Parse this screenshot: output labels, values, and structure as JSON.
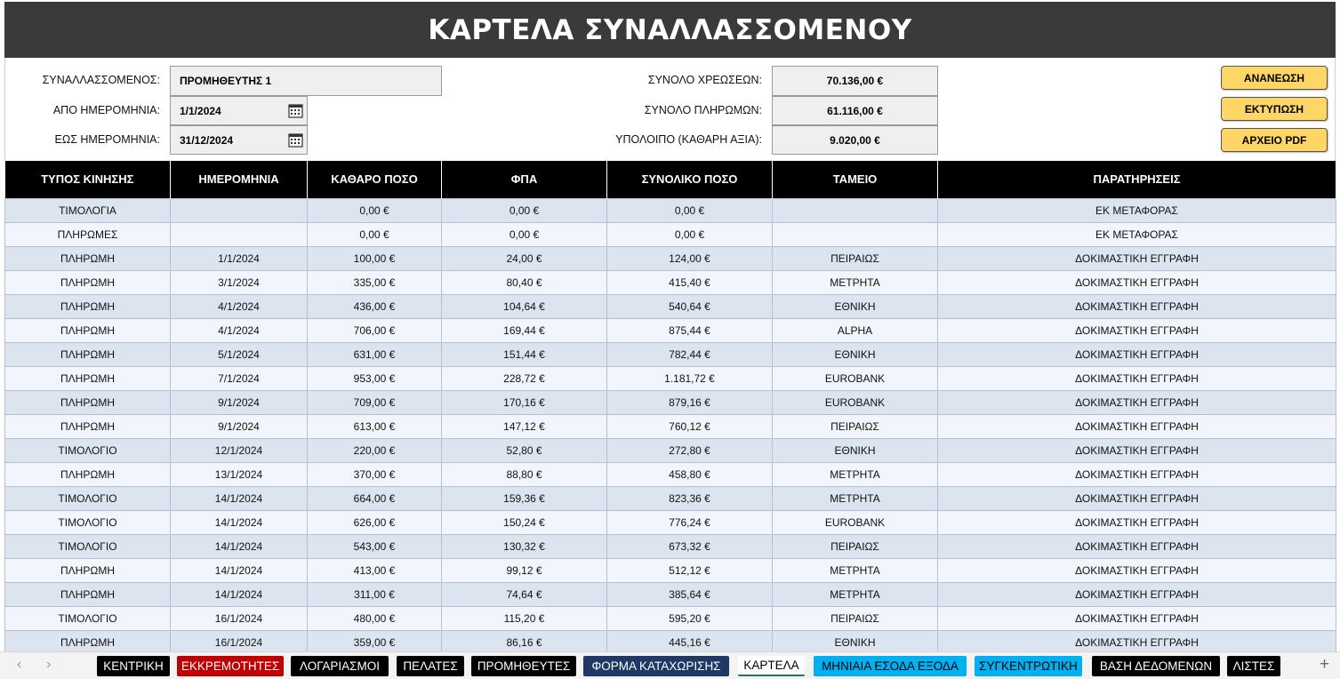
{
  "title": "ΚΑΡΤΕΛΑ ΣΥΝΑΛΛΑΣΣΟΜΕΝΟΥ",
  "form": {
    "party_label": "ΣΥΝΑΛΛΑΣΣΟΜΕΝΟΣ:",
    "party_value": "ΠΡΟΜΗΘΕΥΤΗΣ 1",
    "from_label": "ΑΠΟ ΗΜΕΡΟΜΗΝΙΑ:",
    "from_value": "1/1/2024",
    "to_label": "ΕΩΣ ΗΜΕΡΟΜΗΝΙΑ:",
    "to_value": "31/12/2024",
    "charges_label": "ΣΥΝΟΛΟ ΧΡΕΩΣΕΩΝ:",
    "charges_value": "70.136,00 €",
    "payments_label": "ΣΥΝΟΛΟ ΠΛΗΡΩΜΩΝ:",
    "payments_value": "61.116,00 €",
    "balance_label": "ΥΠΟΛΟΙΠΟ (ΚΑΘΑΡΗ ΑΞΙΑ):",
    "balance_value": "9.020,00 €"
  },
  "buttons": {
    "refresh": "ΑΝΑΝΕΩΣΗ",
    "print": "ΕΚΤΥΠΩΣΗ",
    "pdf": "ΑΡΧΕΙΟ PDF",
    "color": "#fdd665"
  },
  "table": {
    "headers": [
      "ΤΥΠΟΣ ΚΙΝΗΣΗΣ",
      "ΗΜΕΡΟΜΗΝΙΑ",
      "ΚΑΘΑΡΟ ΠΟΣΟ",
      "ΦΠΑ",
      "ΣΥΝΟΛΙΚΟ ΠΟΣΟ",
      "ΤΑΜΕΙΟ",
      "ΠΑΡΑΤΗΡΗΣΕΙΣ"
    ],
    "rows": [
      [
        "ΤΙΜΟΛΟΓΙΑ",
        "",
        "0,00 €",
        "0,00 €",
        "0,00 €",
        "",
        "ΕΚ ΜΕΤΑΦΟΡΑΣ"
      ],
      [
        "ΠΛΗΡΩΜΕΣ",
        "",
        "0,00 €",
        "0,00 €",
        "0,00 €",
        "",
        "ΕΚ ΜΕΤΑΦΟΡΑΣ"
      ],
      [
        "ΠΛΗΡΩΜΗ",
        "1/1/2024",
        "100,00 €",
        "24,00 €",
        "124,00 €",
        "ΠΕΙΡΑΙΩΣ",
        "ΔΟΚΙΜΑΣΤΙΚΗ ΕΓΓΡΑΦΗ"
      ],
      [
        "ΠΛΗΡΩΜΗ",
        "3/1/2024",
        "335,00 €",
        "80,40 €",
        "415,40 €",
        "ΜΕΤΡΗΤΑ",
        "ΔΟΚΙΜΑΣΤΙΚΗ ΕΓΓΡΑΦΗ"
      ],
      [
        "ΠΛΗΡΩΜΗ",
        "4/1/2024",
        "436,00 €",
        "104,64 €",
        "540,64 €",
        "ΕΘΝΙΚΗ",
        "ΔΟΚΙΜΑΣΤΙΚΗ ΕΓΓΡΑΦΗ"
      ],
      [
        "ΠΛΗΡΩΜΗ",
        "4/1/2024",
        "706,00 €",
        "169,44 €",
        "875,44 €",
        "ALPHA",
        "ΔΟΚΙΜΑΣΤΙΚΗ ΕΓΓΡΑΦΗ"
      ],
      [
        "ΠΛΗΡΩΜΗ",
        "5/1/2024",
        "631,00 €",
        "151,44 €",
        "782,44 €",
        "ΕΘΝΙΚΗ",
        "ΔΟΚΙΜΑΣΤΙΚΗ ΕΓΓΡΑΦΗ"
      ],
      [
        "ΠΛΗΡΩΜΗ",
        "7/1/2024",
        "953,00 €",
        "228,72 €",
        "1.181,72 €",
        "EUROBANK",
        "ΔΟΚΙΜΑΣΤΙΚΗ ΕΓΓΡΑΦΗ"
      ],
      [
        "ΠΛΗΡΩΜΗ",
        "9/1/2024",
        "709,00 €",
        "170,16 €",
        "879,16 €",
        "EUROBANK",
        "ΔΟΚΙΜΑΣΤΙΚΗ ΕΓΓΡΑΦΗ"
      ],
      [
        "ΠΛΗΡΩΜΗ",
        "9/1/2024",
        "613,00 €",
        "147,12 €",
        "760,12 €",
        "ΠΕΙΡΑΙΩΣ",
        "ΔΟΚΙΜΑΣΤΙΚΗ ΕΓΓΡΑΦΗ"
      ],
      [
        "ΤΙΜΟΛΟΓΙΟ",
        "12/1/2024",
        "220,00 €",
        "52,80 €",
        "272,80 €",
        "ΕΘΝΙΚΗ",
        "ΔΟΚΙΜΑΣΤΙΚΗ ΕΓΓΡΑΦΗ"
      ],
      [
        "ΠΛΗΡΩΜΗ",
        "13/1/2024",
        "370,00 €",
        "88,80 €",
        "458,80 €",
        "ΜΕΤΡΗΤΑ",
        "ΔΟΚΙΜΑΣΤΙΚΗ ΕΓΓΡΑΦΗ"
      ],
      [
        "ΤΙΜΟΛΟΓΙΟ",
        "14/1/2024",
        "664,00 €",
        "159,36 €",
        "823,36 €",
        "ΜΕΤΡΗΤΑ",
        "ΔΟΚΙΜΑΣΤΙΚΗ ΕΓΓΡΑΦΗ"
      ],
      [
        "ΤΙΜΟΛΟΓΙΟ",
        "14/1/2024",
        "626,00 €",
        "150,24 €",
        "776,24 €",
        "EUROBANK",
        "ΔΟΚΙΜΑΣΤΙΚΗ ΕΓΓΡΑΦΗ"
      ],
      [
        "ΤΙΜΟΛΟΓΙΟ",
        "14/1/2024",
        "543,00 €",
        "130,32 €",
        "673,32 €",
        "ΠΕΙΡΑΙΩΣ",
        "ΔΟΚΙΜΑΣΤΙΚΗ ΕΓΓΡΑΦΗ"
      ],
      [
        "ΠΛΗΡΩΜΗ",
        "14/1/2024",
        "413,00 €",
        "99,12 €",
        "512,12 €",
        "ΜΕΤΡΗΤΑ",
        "ΔΟΚΙΜΑΣΤΙΚΗ ΕΓΓΡΑΦΗ"
      ],
      [
        "ΠΛΗΡΩΜΗ",
        "14/1/2024",
        "311,00 €",
        "74,64 €",
        "385,64 €",
        "ΜΕΤΡΗΤΑ",
        "ΔΟΚΙΜΑΣΤΙΚΗ ΕΓΓΡΑΦΗ"
      ],
      [
        "ΤΙΜΟΛΟΓΙΟ",
        "16/1/2024",
        "480,00 €",
        "115,20 €",
        "595,20 €",
        "ΠΕΙΡΑΙΩΣ",
        "ΔΟΚΙΜΑΣΤΙΚΗ ΕΓΓΡΑΦΗ"
      ],
      [
        "ΠΛΗΡΩΜΗ",
        "16/1/2024",
        "359,00 €",
        "86,16 €",
        "445,16 €",
        "ΕΘΝΙΚΗ",
        "ΔΟΚΙΜΑΣΤΙΚΗ ΕΓΓΡΑΦΗ"
      ]
    ]
  },
  "sheet_tabs": [
    {
      "label": "ΚΕΝΤΡΙΚΗ",
      "bg": "#000000",
      "fg": "#ffffff"
    },
    {
      "label": "ΕΚΚΡΕΜΟΤΗΤΕΣ",
      "bg": "#c00000",
      "fg": "#ffffff"
    },
    {
      "label": "ΛΟΓΑΡΙΑΣΜΟΙ",
      "bg": "#000000",
      "fg": "#ffffff"
    },
    {
      "label": "ΠΕΛΑΤΕΣ",
      "bg": "#000000",
      "fg": "#ffffff"
    },
    {
      "label": "ΠΡΟΜΗΘΕΥΤΕΣ",
      "bg": "#000000",
      "fg": "#ffffff"
    },
    {
      "label": "ΦΟΡΜΑ ΚΑΤΑΧΩΡΙΣΗΣ",
      "bg": "#1f3864",
      "fg": "#ffffff"
    },
    {
      "label": "ΚΑΡΤΕΛΑ",
      "bg": "#ffffff",
      "fg": "#000000",
      "active": true
    },
    {
      "label": "ΜΗΝΙΑΙΑ ΕΣΟΔΑ ΕΞΟΔΑ",
      "bg": "#00b0f0",
      "fg": "#000000"
    },
    {
      "label": "ΣΥΓΚΕΝΤΡΩΤΙΚΗ",
      "bg": "#00b0f0",
      "fg": "#000000"
    },
    {
      "label": "ΒΑΣΗ ΔΕΔΟΜΕΝΩΝ",
      "bg": "#000000",
      "fg": "#ffffff"
    },
    {
      "label": "ΛΙΣΤΕΣ",
      "bg": "#000000",
      "fg": "#ffffff"
    }
  ],
  "icons": {
    "calendar": "calendar-icon",
    "prev": "chevron-left-icon",
    "next": "chevron-right-icon",
    "add": "plus-icon"
  }
}
